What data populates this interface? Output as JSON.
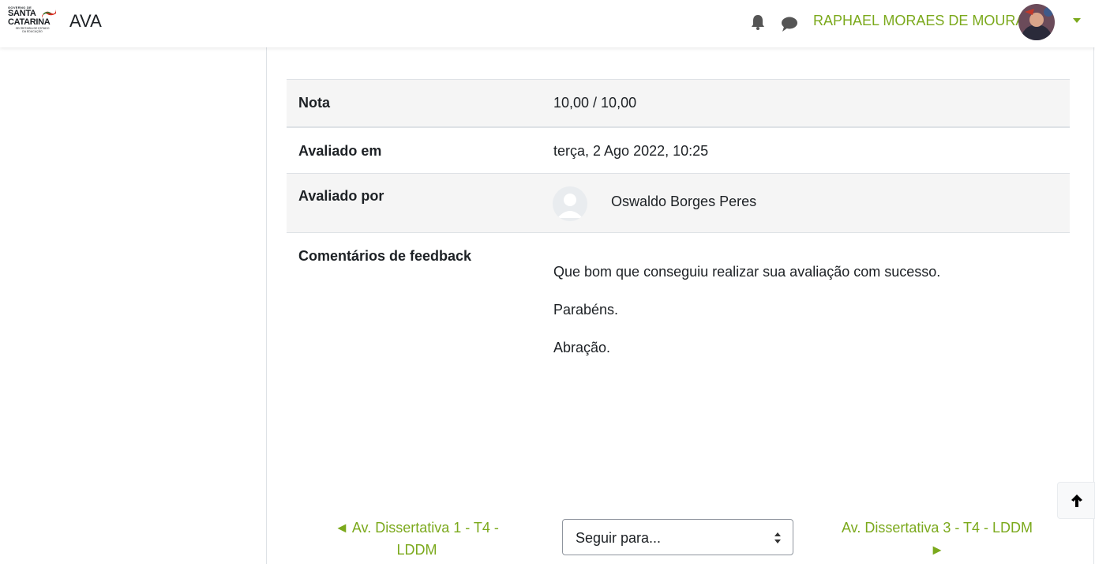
{
  "header": {
    "logo_line1": "GOVERNO DE",
    "logo_line2": "SANTA",
    "logo_line3": "CATARINA",
    "logo_line4": "SECRETARIA DE ESTADO",
    "logo_line5": "DA EDUCAÇÃO",
    "site_name": "AVA",
    "user_name": "RAPHAEL MORAES DE MOURA",
    "accent_color": "#7ba91c",
    "icons": [
      "bell-icon",
      "chat-icon",
      "caret-down-icon"
    ]
  },
  "grade": {
    "rows": [
      {
        "label": "Nota",
        "value": "10,00 / 10,00"
      },
      {
        "label": "Avaliado em",
        "value": "terça, 2 Ago 2022, 10:25"
      },
      {
        "label": "Avaliado por",
        "value": "Oswaldo Borges Peres"
      },
      {
        "label": "Comentários de feedback"
      }
    ],
    "feedback": [
      "Que bom que conseguiu realizar sua avaliação com sucesso.",
      "Parabéns.",
      "Abração."
    ]
  },
  "activity_nav": {
    "prev_line1": "◄ Av. Dissertativa 1 - T4 -",
    "prev_line2": "LDDM",
    "jump_placeholder": "Seguir para...",
    "next_line1": "Av. Dissertativa 3 - T4 - LDDM",
    "next_line2": "►"
  }
}
